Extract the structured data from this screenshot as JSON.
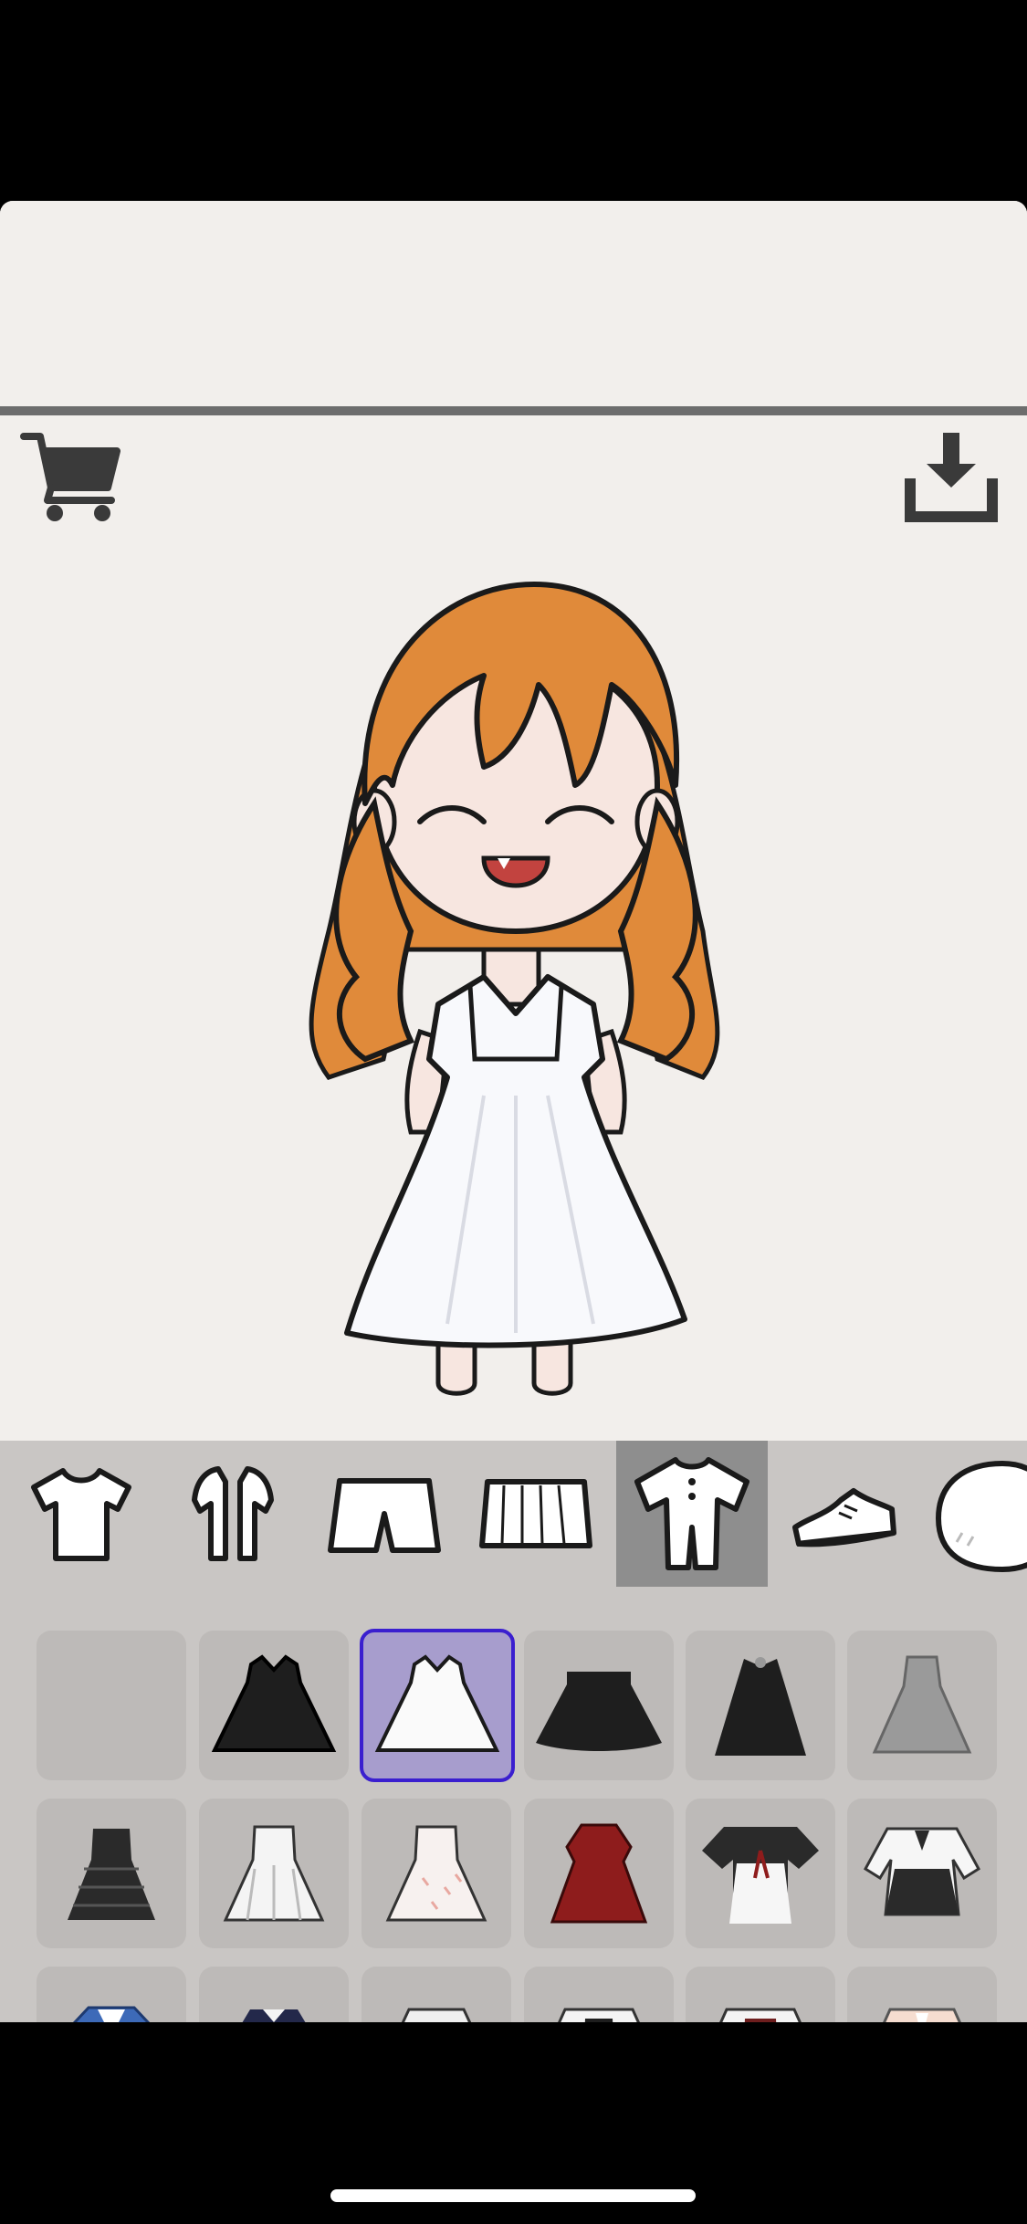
{
  "toolbar": {
    "cart_icon": "cart-icon",
    "download_icon": "download-icon"
  },
  "categories": [
    {
      "name": "tshirt-icon",
      "selected": false
    },
    {
      "name": "jacket-icon",
      "selected": false
    },
    {
      "name": "shorts-icon",
      "selected": false
    },
    {
      "name": "skirt-icon",
      "selected": false
    },
    {
      "name": "onepiece-icon",
      "selected": true
    },
    {
      "name": "shoe-icon",
      "selected": false
    },
    {
      "name": "head-icon",
      "selected": false
    }
  ],
  "items": [
    {
      "name": "empty-slot",
      "selected": false
    },
    {
      "name": "black-dress",
      "selected": false
    },
    {
      "name": "white-dress",
      "selected": true
    },
    {
      "name": "black-flared-dress",
      "selected": false
    },
    {
      "name": "black-long-dress",
      "selected": false
    },
    {
      "name": "gray-dress",
      "selected": false
    },
    {
      "name": "black-pinafore-dress",
      "selected": false
    },
    {
      "name": "white-pattern-dress",
      "selected": false
    },
    {
      "name": "white-feather-dress",
      "selected": false
    },
    {
      "name": "red-dress",
      "selected": false
    },
    {
      "name": "hanbok-dress",
      "selected": false
    },
    {
      "name": "black-white-dress",
      "selected": false
    },
    {
      "name": "blue-kimono",
      "selected": false
    },
    {
      "name": "navy-dress",
      "selected": false
    },
    {
      "name": "gray-collar-dress",
      "selected": false
    },
    {
      "name": "black-cardigan-dress",
      "selected": false
    },
    {
      "name": "maroon-dress",
      "selected": false
    },
    {
      "name": "peach-dress",
      "selected": false
    }
  ],
  "colors": {
    "background": "#f2efec",
    "tray": "#c9c6c4",
    "selected_item": "#a79dcd",
    "selected_border": "#3a1fcf",
    "hair": "#e08a3a"
  }
}
